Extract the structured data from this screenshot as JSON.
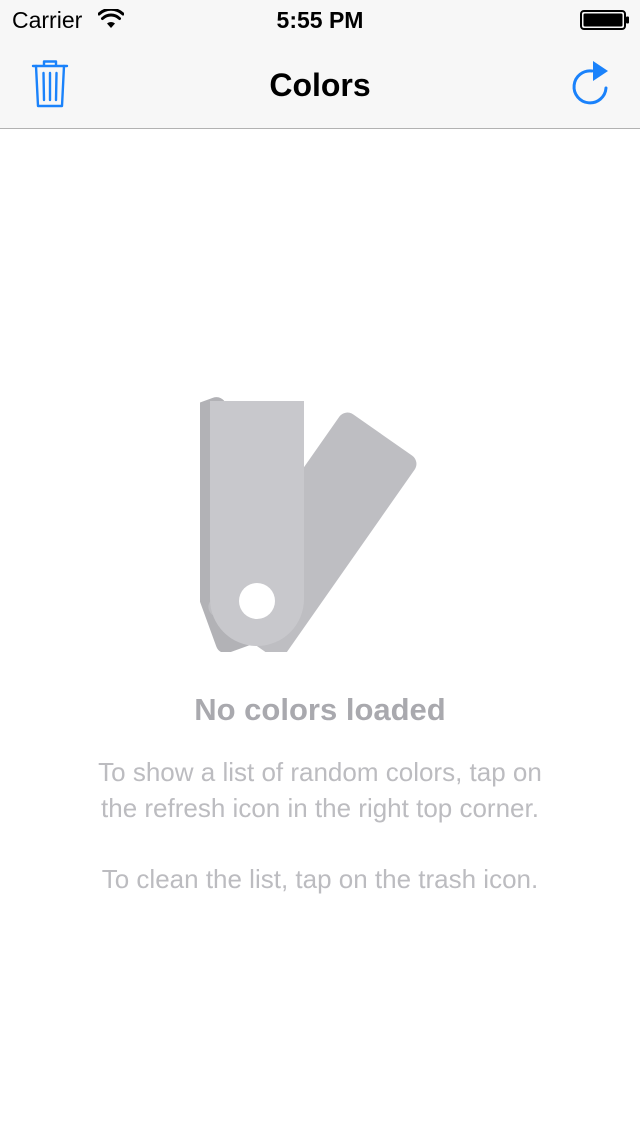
{
  "status_bar": {
    "carrier": "Carrier",
    "time": "5:55 PM",
    "wifi_icon": "wifi-icon",
    "battery_icon": "battery-full-icon"
  },
  "nav_bar": {
    "title": "Colors",
    "left_icon": "trash-icon",
    "right_icon": "refresh-icon",
    "tint_color": "#1a82fb",
    "background_color": "#f7f7f7"
  },
  "empty_state": {
    "icon": "color-swatch-icon",
    "title": "No colors loaded",
    "description_refresh": "To show a list of random colors, tap on\nthe refresh icon in the right top corner.",
    "description_clean": "To clean the list, tap on the trash icon.",
    "title_color": "#a9a9ae",
    "text_color": "#bcbcc0",
    "swatch_colors": [
      "#c8c8cc",
      "#bebec2",
      "#b2b2b6"
    ]
  }
}
